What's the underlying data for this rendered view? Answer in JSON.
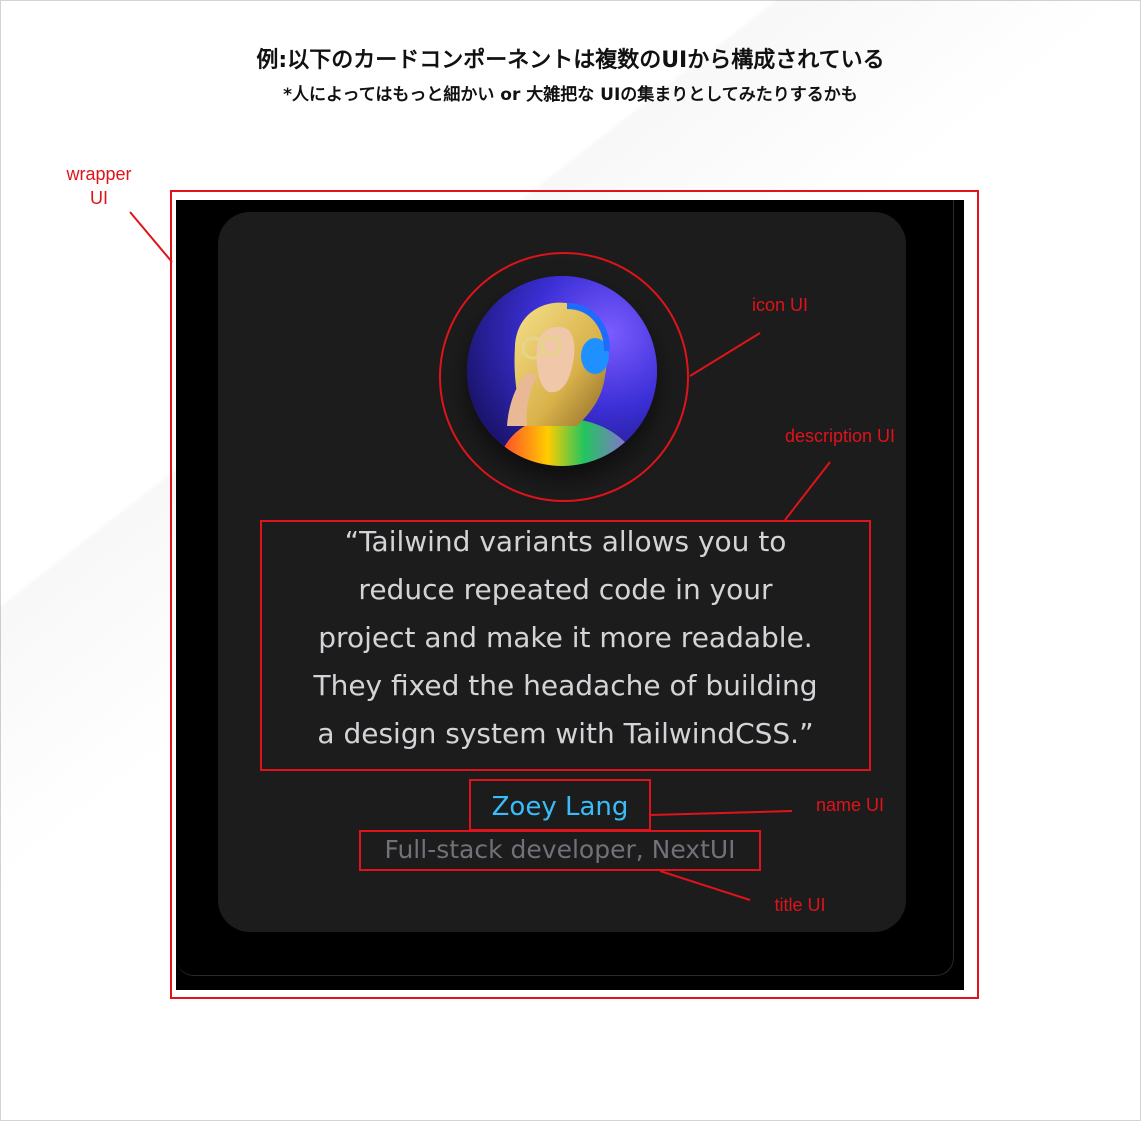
{
  "heading": {
    "title": "例:以下のカードコンポーネントは複数のUIから構成されている",
    "subtitle": "*人によってはもっと細かい or 大雑把な UIの集まりとしてみたりするかも"
  },
  "card": {
    "quote": "“Tailwind variants allows you to reduce repeated code in your project and make it more readable. They fixed the headache of building a design system with TailwindCSS.”",
    "quote_lines": [
      "“Tailwind variants allows you to",
      "reduce repeated code in your",
      "project and make it more readable.",
      "They fixed the headache of building",
      "a design system with TailwindCSS.”"
    ],
    "name": "Zoey Lang",
    "title": "Full-stack developer, NextUI"
  },
  "annotations": {
    "wrapper_line1": "wrapper",
    "wrapper_line2": "UI",
    "icon": "icon UI",
    "description": "description UI",
    "name": "name UI",
    "title": "title UI"
  },
  "colors": {
    "annotation": "#e0131a",
    "card_background": "#1c1c1c",
    "page_background": "#000000",
    "name": "#38bdf8",
    "title": "#71717a",
    "quote": "#d4d4d8"
  },
  "icons": {
    "avatar": "person-with-headphones-avatar"
  }
}
